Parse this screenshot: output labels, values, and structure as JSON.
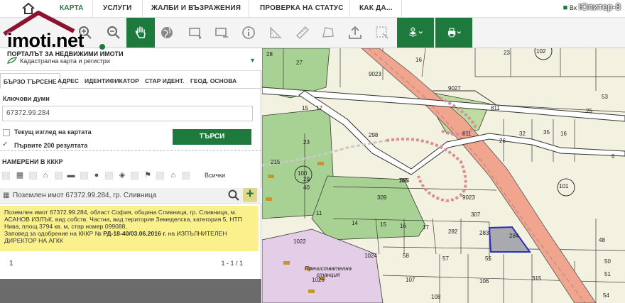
{
  "nav": {
    "items": [
      "КАРТА",
      "УСЛУГИ",
      "ЖАЛБИ И ВЪЗРАЖЕНИЯ",
      "ПРОВЕРКА НА СТАТУС",
      "КАК ДА..."
    ],
    "right_link": "Вх",
    "watermark": "Юпитер-8"
  },
  "logo": {
    "word": "imoti.net"
  },
  "portal": {
    "title": "ПОРТАЛЪТ ЗА НЕДВИЖИМИ ИМОТИ",
    "subtitle": "Кадастрална карта и регистри"
  },
  "tabs": [
    "БЪРЗО ТЪРСЕНЕ",
    "АДРЕС",
    "ИДЕНТИФИКАТОР",
    "СТАР ИДЕНТ.",
    "ГЕОД. ОСНОВА"
  ],
  "search": {
    "keywords_label": "Ключови думи",
    "keywords_value": "67372.99.284",
    "current_view_label": "Текущ изглед на картата",
    "first_200_label": "Първите 200 резултата",
    "button_label": "ТЪРСИ"
  },
  "results": {
    "found_label": "НАМЕРЕНИ В КККР",
    "all_label": "Всички",
    "item_title": "Поземлен имот 67372.99.284, гр. Сливница",
    "description": "Поземлен имот 67372.99.284, област София, община Сливница, гр. Сливница, м. АСАНОВ ИЗЛЪК, вид собств. Частна, вид територия Земеделска, категория 5, НТП Нива, площ 3794 кв. м, стар номер 099088,",
    "order_prefix": "Заповед за одобрение на КККР №",
    "order_number": "РД-18-40/03.06.2016 г.",
    "order_suffix": "на ИЗПЪЛНИТЕЛЕН ДИРЕКТОР НА АГКК",
    "page": "1",
    "range": "1 - 1 / 1"
  },
  "colors": {
    "green": "#1e7a3c",
    "highlight": "#faf18c",
    "road": "#f1a58f"
  },
  "map": {
    "labels": [
      "28",
      "27",
      "16",
      "23",
      "102",
      "53",
      "9023",
      "9027",
      "17",
      "15",
      "811",
      "25",
      "298",
      "811",
      "32",
      "35",
      "16",
      "26",
      "6",
      "23",
      "215",
      "100",
      "105",
      "29",
      "40",
      "101",
      "309",
      "305",
      "9023",
      "11",
      "14",
      "15",
      "16",
      "17",
      "307",
      "282",
      "283",
      "284",
      "48",
      "1022",
      "1024",
      "58",
      "57",
      "55",
      "50",
      "51",
      "1026",
      "107",
      "106",
      "108",
      "315",
      "54",
      "Пречиствателна станция"
    ]
  }
}
